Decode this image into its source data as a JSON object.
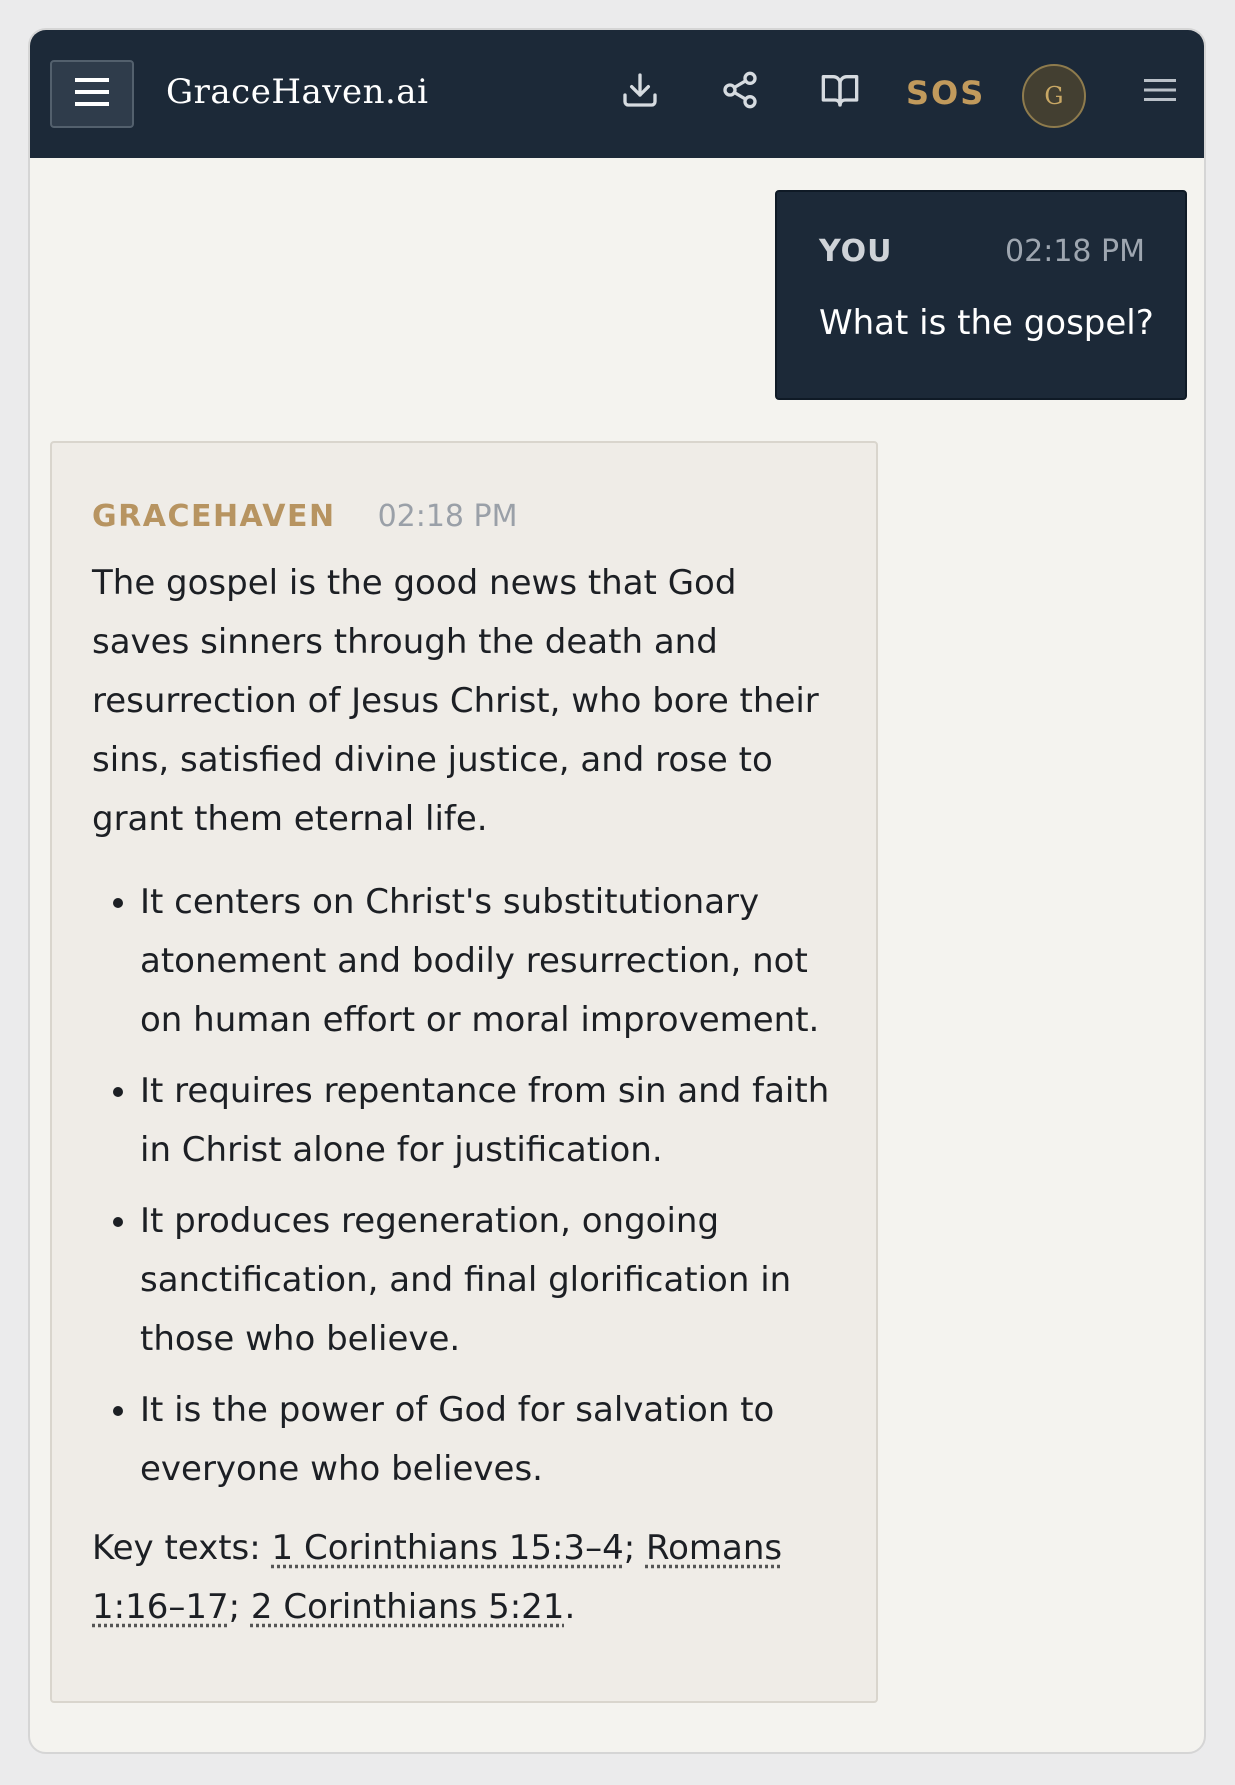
{
  "header": {
    "brand": "GraceHaven.ai",
    "sos_label": "SOS",
    "avatar_initial": "G",
    "icons": [
      "menu-toggle-icon",
      "download-icon",
      "share-icon",
      "book-icon",
      "hamburger-menu-icon"
    ]
  },
  "conversation": {
    "user_message": {
      "sender": "YOU",
      "time": "02:18 PM",
      "text": "What is the gospel?"
    },
    "assistant_message": {
      "sender": "GRACEHAVEN",
      "time": "02:18 PM",
      "intro": "The gospel is the good news that God saves sinners through the death and resurrection of Jesus Christ, who bore their sins, satisfied divine justice, and rose to grant them eternal life.",
      "bullets": [
        "It centers on Christ's substitutionary atonement and bodily resurrection, not on human effort or moral improvement.",
        "It requires repentance from sin and faith in Christ alone for justification.",
        "It produces regeneration, ongoing sanctification, and final glorification in those who believe.",
        "It is the power of God for salvation to everyone who believes."
      ],
      "key_texts_label": "Key texts: ",
      "references": [
        "1 Corinthians 15:3–4",
        "Romans 1:16–17",
        "2 Corinthians 5:21"
      ],
      "separator": "; ",
      "end_punct": "."
    }
  },
  "colors": {
    "header_bg": "#1c2938",
    "accent_gold": "#c19a5c",
    "page_bg": "#f4f3ef",
    "assistant_bubble_bg": "#efece7"
  }
}
